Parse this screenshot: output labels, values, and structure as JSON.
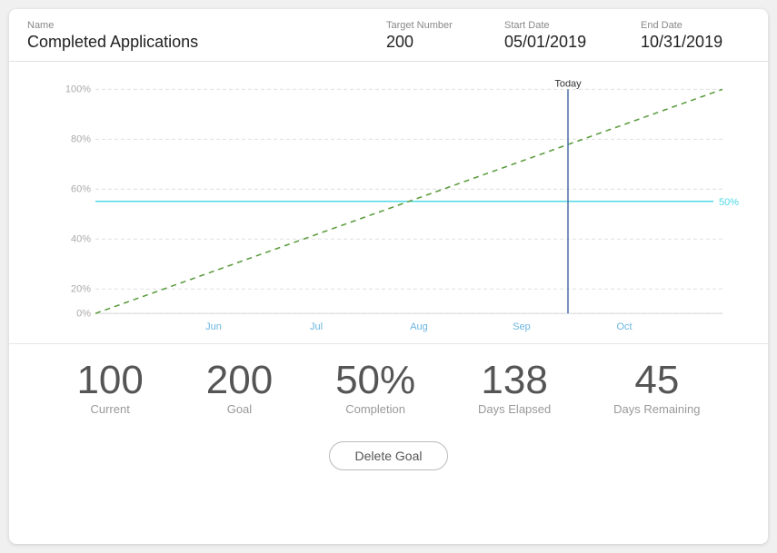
{
  "header": {
    "name_label": "Name",
    "name_value": "Completed Applications",
    "target_label": "Target Number",
    "target_value": "200",
    "start_label": "Start Date",
    "start_value": "05/01/2019",
    "end_label": "End Date",
    "end_value": "10/31/2019"
  },
  "chart": {
    "today_label": "Today",
    "y_labels": [
      "100%",
      "80%",
      "60%",
      "40%",
      "20%",
      "0%"
    ],
    "x_labels": [
      "Jun",
      "Jul",
      "Aug",
      "Sep",
      "Oct"
    ],
    "percent_label": "50%"
  },
  "stats": [
    {
      "value": "100",
      "label": "Current"
    },
    {
      "value": "200",
      "label": "Goal"
    },
    {
      "value": "50%",
      "label": "Completion"
    },
    {
      "value": "138",
      "label": "Days Elapsed"
    },
    {
      "value": "45",
      "label": "Days Remaining"
    }
  ],
  "footer": {
    "delete_label": "Delete Goal"
  }
}
